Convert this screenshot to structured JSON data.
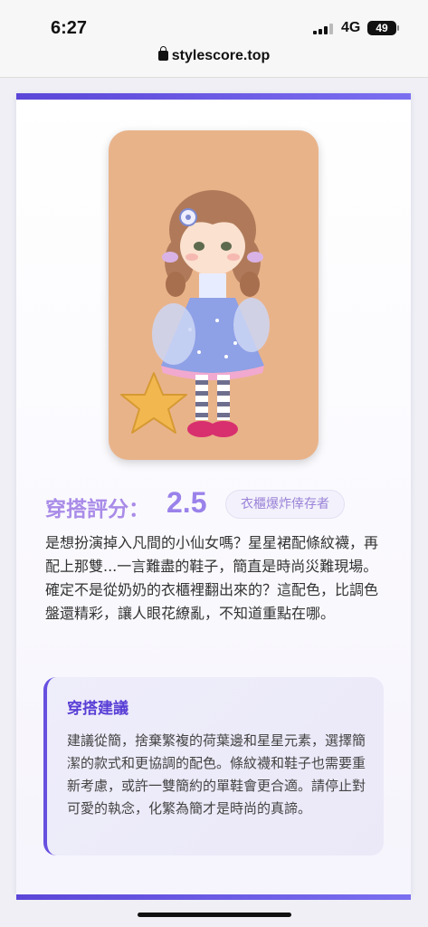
{
  "status_bar": {
    "time": "6:27",
    "network": "4G",
    "battery": "49"
  },
  "browser": {
    "url": "stylescore.top"
  },
  "result": {
    "score_label": "穿搭評分：",
    "score_value": "2.5",
    "tag": "衣櫃爆炸倖存者",
    "review": "是想扮演掉入凡間的小仙女嗎？星星裙配條紋襪，再配上那雙...一言難盡的鞋子，簡直是時尚災難現場。確定不是從奶奶的衣櫃裡翻出來的？這配色，比調色盤還精彩，讓人眼花繚亂，不知道重點在哪。"
  },
  "advice": {
    "title": "穿搭建議",
    "body": "建議從簡，捨棄繁複的荷葉邊和星星元素，選擇簡潔的款式和更協調的配色。條紋襪和鞋子也需要重新考慮，或許一雙簡約的單鞋會更合適。請停止對可愛的執念，化繁為簡才是時尚的真諦。"
  },
  "colors": {
    "accent": "#5b46d8",
    "score": "#9a82ea",
    "photo_bg": "#e9b38a"
  }
}
